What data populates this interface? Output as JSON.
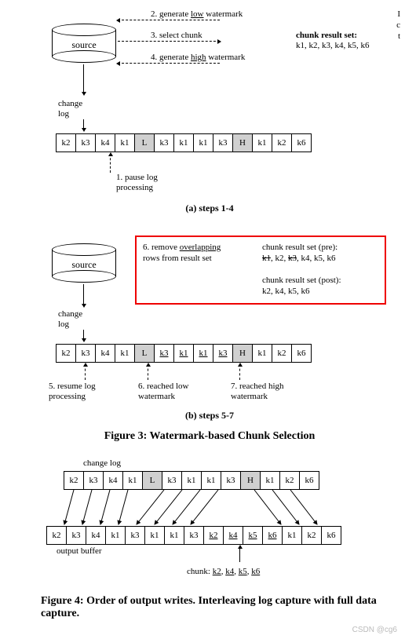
{
  "A": {
    "source": "source",
    "changelog": "change\nlog",
    "s2": "2. generate low watermark",
    "underline2": "low",
    "s3": "3. select chunk",
    "s4": "4. generate high watermark",
    "underline4": "high",
    "crs": "chunk result set:",
    "crsv": "k1, k2, k3, k4, k5, k6",
    "s1": "1. pause log\nprocessing",
    "cells": [
      "k2",
      "k3",
      "k4",
      "k1",
      "L",
      "k3",
      "k1",
      "k1",
      "k3",
      "H",
      "k1",
      "k2",
      "k6"
    ],
    "cap": "(a) steps 1-4"
  },
  "B": {
    "source": "source",
    "changelog": "change\nlog",
    "box6a": "6. remove ",
    "box6u": "overlapping",
    "box6b": "\nrows from result set",
    "pre": "chunk result set (pre):",
    "prev": [
      "k1",
      ", k2, ",
      "k3",
      ", k4, k5, k6"
    ],
    "post": "chunk result set (post):",
    "postv": "k2, k4, k5, k6",
    "cells": [
      "k2",
      "k3",
      "k4",
      "k1",
      "L",
      "k3",
      "k1",
      "k1",
      "k3",
      "H",
      "k1",
      "k2",
      "k6"
    ],
    "s5": "5. resume log\nprocessing",
    "s6": "6. reached low\nwatermark",
    "s7": "7. reached high\nwatermark",
    "cap": "(b) steps 5-7"
  },
  "fig3": "Figure 3: Watermark-based Chunk Selection",
  "C": {
    "changelog": "change log",
    "top": [
      "k2",
      "k3",
      "k4",
      "k1",
      "L",
      "k3",
      "k1",
      "k1",
      "k3",
      "H",
      "k1",
      "k2",
      "k6"
    ],
    "bot": [
      "k2",
      "k3",
      "k4",
      "k1",
      "k3",
      "k1",
      "k1",
      "k3",
      "k2",
      "k4",
      "k5",
      "k6",
      "k1",
      "k2",
      "k6"
    ],
    "out": "output buffer",
    "chunk": "chunk: ",
    "chunkv": [
      "k2",
      ", ",
      "k4",
      ", ",
      "k5",
      ", ",
      "k6"
    ]
  },
  "fig4": "Figure 4: Order of output writes. Interleaving log capture with full data capture.",
  "wm": "CSDN @cg6"
}
